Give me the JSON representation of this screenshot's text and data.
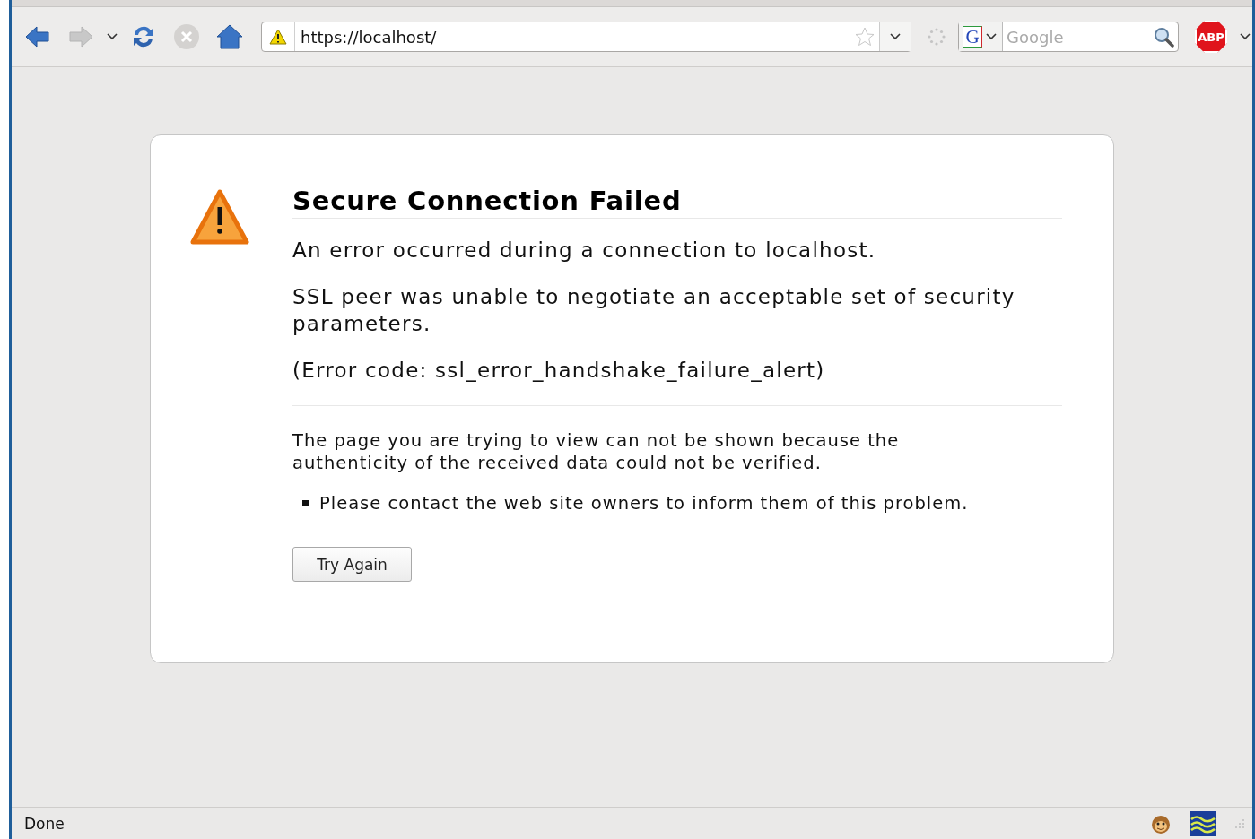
{
  "toolbar": {
    "address": {
      "url": "https://localhost/",
      "insecure": true
    },
    "search": {
      "engine_letter": "G",
      "placeholder": "Google"
    },
    "adblock_label": "ABP"
  },
  "error_page": {
    "title": "Secure Connection Failed",
    "paragraphs": [
      "An error occurred during a connection to localhost.",
      "SSL peer was unable to negotiate an acceptable set of security parameters.",
      "(Error code: ssl_error_handshake_failure_alert)"
    ],
    "description": "The page you are trying to view can not be shown because the authenticity of the received data could not be verified.",
    "bullets": [
      "Please contact the web site owners to inform them of this problem."
    ],
    "button": "Try Again"
  },
  "status_bar": {
    "text": "Done"
  }
}
